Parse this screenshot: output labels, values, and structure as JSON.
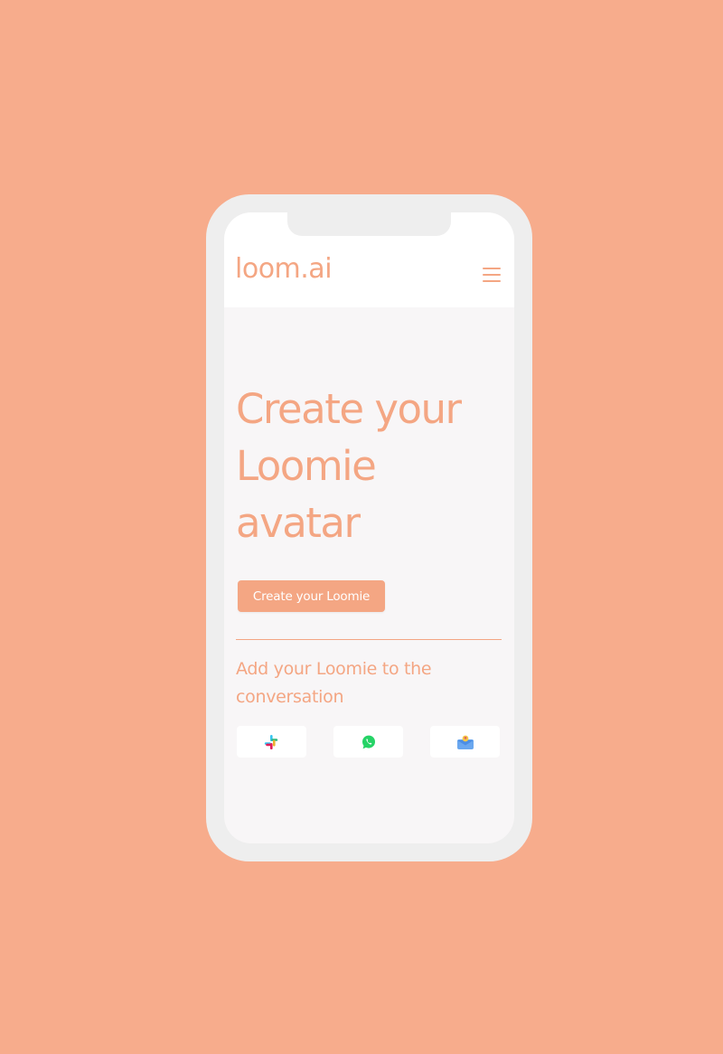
{
  "header": {
    "logo_text": "loom.ai"
  },
  "hero": {
    "title_lines": [
      "Create your",
      "Loomie",
      "avatar"
    ],
    "cta_label": "Create your Loomie"
  },
  "integrations": {
    "heading": "Add your Loomie to the conversation",
    "apps": [
      {
        "icon": "slack-icon"
      },
      {
        "icon": "whatsapp-icon"
      },
      {
        "icon": "imessage-icon"
      }
    ]
  },
  "colors": {
    "background": "#f7ac8c",
    "accent": "#f4a683",
    "phone_frame": "#eeeeee",
    "screen": "#f8f6f7",
    "header": "#ffffff"
  }
}
